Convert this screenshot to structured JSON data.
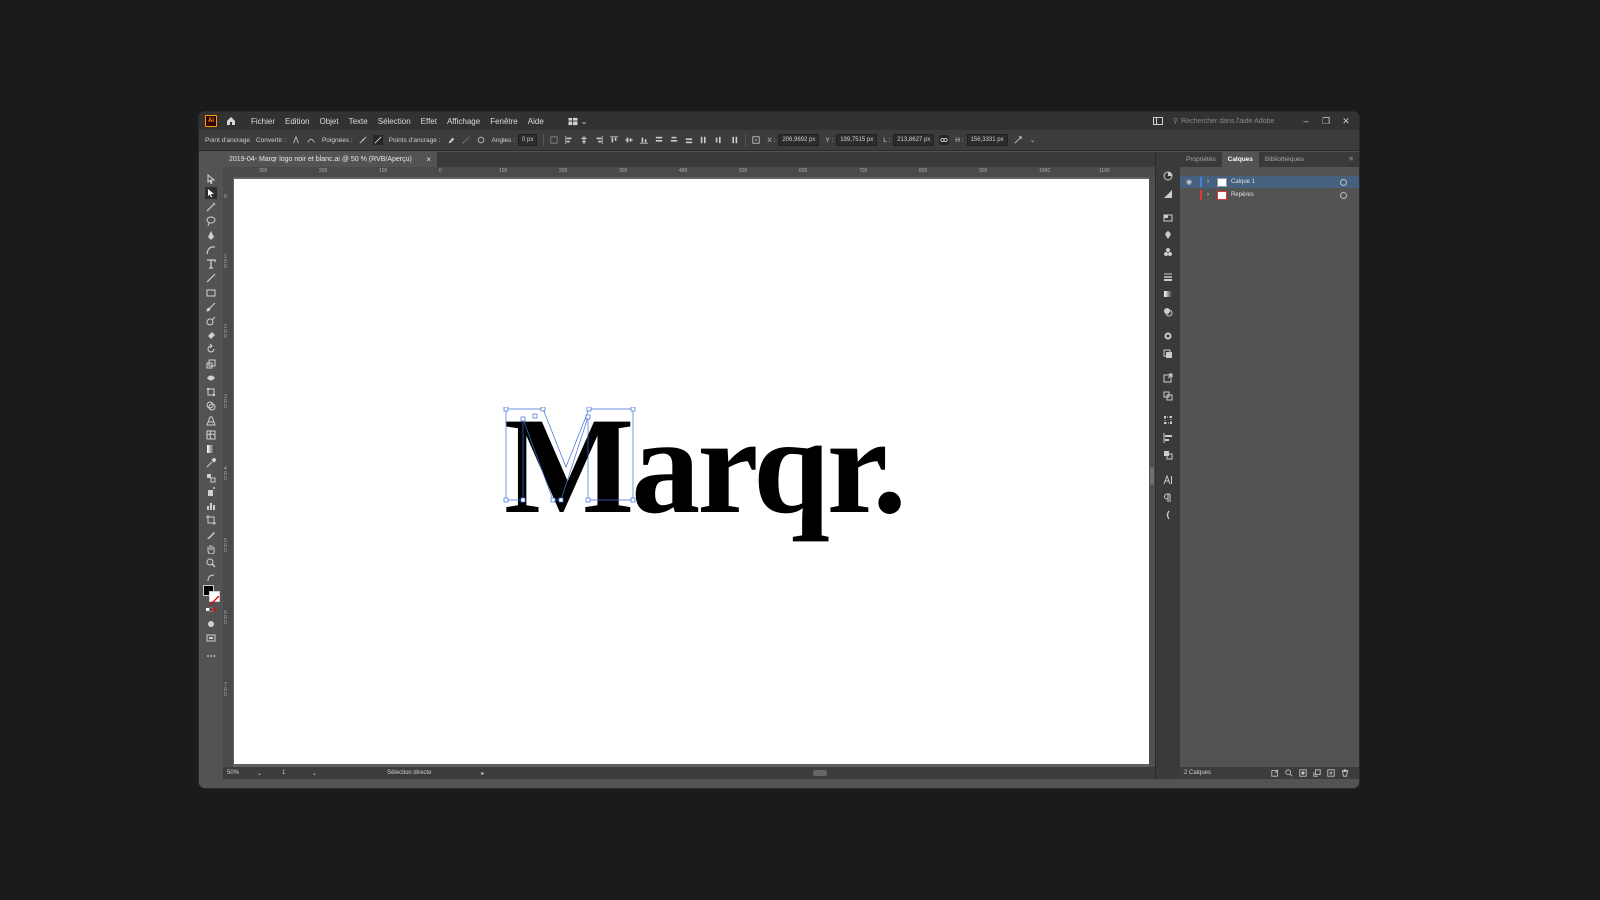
{
  "menubar": {
    "app_badge": "Ai",
    "items": [
      "Fichier",
      "Edition",
      "Objet",
      "Texte",
      "Sélection",
      "Effet",
      "Affichage",
      "Fenêtre",
      "Aide"
    ],
    "search_placeholder": "Rechercher dans l'aide Adobe"
  },
  "control_bar": {
    "anchor_label": "Point d'ancrage",
    "convert_label": "Convertir :",
    "handles_label": "Poignées :",
    "anchor_points_label": "Points d'ancrage :",
    "corners_label": "Angles :",
    "corners_value": "0 px",
    "x_label": "X :",
    "x_value": "206,9692 px",
    "y_label": "Y :",
    "y_value": "199,7515 px",
    "w_label": "L :",
    "w_value": "213,8627 px",
    "h_label": "H :",
    "h_value": "156,3331 px"
  },
  "document": {
    "tab_title": "2019-04- Marqr logo noir et blanc.ai @ 50 % (RVB/Aperçu)",
    "logo_text": "Marqr."
  },
  "ruler": {
    "h_ticks": [
      "300",
      "200",
      "100",
      "0",
      "100",
      "200",
      "300",
      "400",
      "500",
      "600",
      "700",
      "800",
      "900",
      "1000",
      "1100"
    ],
    "v_ticks": [
      "0",
      "1 0 0",
      "2 0 0",
      "3 0 0",
      "4 0 0",
      "5 0 0",
      "6 0 0",
      "7 0 0"
    ]
  },
  "status_bar": {
    "zoom": "50%",
    "artboard": "1",
    "tool_status": "Sélection directe"
  },
  "panel": {
    "tabs": [
      "Propriétés",
      "Calques",
      "Bibliothèques"
    ],
    "active_tab": "Calques",
    "layers": [
      {
        "name": "Calque 1",
        "color": "#4a7fd6",
        "selected": true
      },
      {
        "name": "Repères",
        "color": "#d93a3a",
        "selected": false
      }
    ],
    "footer_count": "2 Calques"
  },
  "colors": {
    "app_badge": "#ff9a00",
    "selection_blue": "#46607f"
  }
}
